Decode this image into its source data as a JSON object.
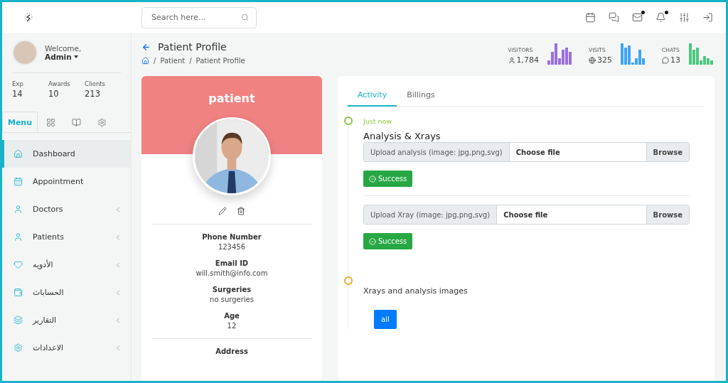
{
  "header": {
    "search": {
      "placeholder": "Search here..."
    },
    "icons": [
      {
        "badge": false
      },
      {
        "badge": false
      },
      {
        "badge": true
      },
      {
        "badge": true
      },
      {
        "badge": false
      },
      {
        "badge": false
      }
    ]
  },
  "sidebar": {
    "welcome": "Welcome,",
    "user": "Admin",
    "stats": [
      {
        "label": "Exp",
        "value": "14"
      },
      {
        "label": "Awards",
        "value": "10"
      },
      {
        "label": "Clients",
        "value": "213"
      }
    ],
    "tabs": [
      {
        "label": "Menu",
        "selected": true
      },
      {
        "selected": false
      },
      {
        "selected": false
      },
      {
        "selected": false
      }
    ],
    "items": [
      {
        "label": "Dashboard",
        "selected": true,
        "expandable": false
      },
      {
        "label": "Appointment",
        "selected": false,
        "expandable": false
      },
      {
        "label": "Doctors",
        "selected": false,
        "expandable": true
      },
      {
        "label": "Patients",
        "selected": false,
        "expandable": true
      },
      {
        "label": "الأدويه",
        "selected": false,
        "expandable": true
      },
      {
        "label": "الحسابات",
        "selected": false,
        "expandable": true
      },
      {
        "label": "التقارير",
        "selected": false,
        "expandable": true
      },
      {
        "label": "الاعدادات",
        "selected": false,
        "expandable": true
      }
    ]
  },
  "page": {
    "title": "Patient Profile",
    "breadcrumb": [
      {
        "separator": "/",
        "label": "Patient"
      },
      {
        "separator": "/",
        "label": "Patient Profile"
      }
    ],
    "stats": [
      {
        "label": "VISITORS",
        "value": "1,784",
        "color": "#9b6ee0"
      },
      {
        "label": "VISITS",
        "value": "325",
        "color": "#3ea4f5"
      },
      {
        "label": "CHATS",
        "value": "13",
        "color": "#4cc77e"
      }
    ]
  },
  "profile": {
    "name": "patient",
    "fields": [
      {
        "label": "Phone Number",
        "value": "123456"
      },
      {
        "label": "Email ID",
        "value": "will.smith@info.com"
      },
      {
        "label": "Surgeries",
        "value": "no surgeries"
      },
      {
        "label": "Age",
        "value": "12"
      }
    ],
    "more_fields": [
      {
        "label": "Address"
      }
    ]
  },
  "activity": {
    "tabs": [
      {
        "label": "Activity",
        "selected": true
      },
      {
        "label": "Billings",
        "selected": false
      }
    ],
    "timeline": [
      {
        "color": "#8cc63f",
        "time": "Just now",
        "title": "Analysis & Xrays",
        "uploads": [
          {
            "label": "Upload analysis (image: jpg,png,svg)",
            "value": "Choose file",
            "button": "Browse",
            "status": "Success"
          },
          {
            "label": "Upload Xray (image: jpg,png,svg)",
            "value": "Choose file",
            "button": "Browse",
            "status": "Success"
          }
        ]
      },
      {
        "color": "#f5a623",
        "subtitle": "Xrays and analysis images",
        "filters": [
          {
            "label": "all",
            "selected": true
          }
        ]
      }
    ]
  }
}
